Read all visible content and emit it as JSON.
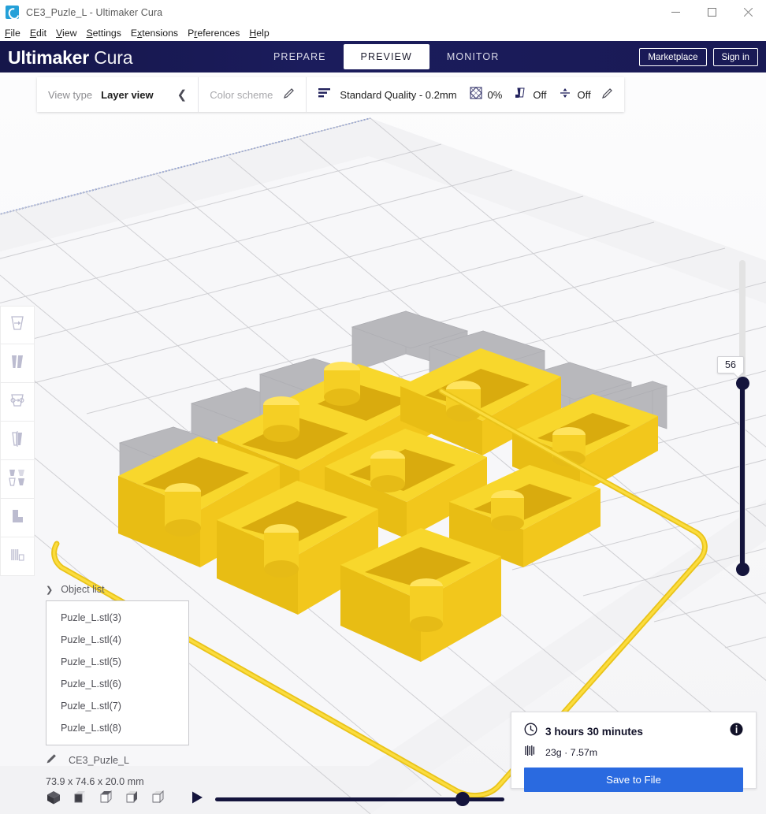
{
  "window": {
    "title": "CE3_Puzle_L - Ultimaker Cura",
    "app_icon": "cura-logo-icon",
    "controls": [
      {
        "name": "minimize-button",
        "glyph": "minimize-icon"
      },
      {
        "name": "maximize-button",
        "glyph": "maximize-icon"
      },
      {
        "name": "close-button",
        "glyph": "close-icon"
      }
    ]
  },
  "menubar": {
    "items": [
      {
        "label": "File",
        "mnemonic": "F"
      },
      {
        "label": "Edit",
        "mnemonic": "E"
      },
      {
        "label": "View",
        "mnemonic": "V"
      },
      {
        "label": "Settings",
        "mnemonic": "S"
      },
      {
        "label": "Extensions",
        "mnemonic": "x"
      },
      {
        "label": "Preferences",
        "mnemonic": "P"
      },
      {
        "label": "Help",
        "mnemonic": "H"
      }
    ]
  },
  "header": {
    "brand_bold": "Ultimaker",
    "brand_light": "Cura",
    "tabs": [
      {
        "label": "PREPARE",
        "active": false
      },
      {
        "label": "PREVIEW",
        "active": true
      },
      {
        "label": "MONITOR",
        "active": false
      }
    ],
    "marketplace_label": "Marketplace",
    "signin_label": "Sign in",
    "bg_color": "#1b1c5c"
  },
  "viewbar": {
    "view_type_label": "View type",
    "view_type_value": "Layer view",
    "collapse_icon": "chevron-left-icon",
    "color_scheme_label": "Color scheme",
    "color_scheme_edit_icon": "pencil-icon",
    "quality_icon": "layer-height-icon",
    "quality_value": "Standard Quality - 0.2mm",
    "infill_icon": "infill-icon",
    "infill_value": "0%",
    "support_icon": "support-icon",
    "support_value": "Off",
    "adhesion_icon": "adhesion-icon",
    "adhesion_value": "Off",
    "settings_edit_icon": "pencil-icon"
  },
  "tools": [
    {
      "name": "move-tool",
      "icon": "move-icon"
    },
    {
      "name": "scale-tool",
      "icon": "scale-icon"
    },
    {
      "name": "rotate-tool",
      "icon": "rotate-icon"
    },
    {
      "name": "mirror-tool",
      "icon": "mirror-icon"
    },
    {
      "name": "per-model-settings-tool",
      "icon": "per-model-settings-icon"
    },
    {
      "name": "support-blocker-tool",
      "icon": "support-blocker-icon"
    },
    {
      "name": "mesh-tool",
      "icon": "mesh-icon"
    }
  ],
  "layer_slider": {
    "value": "56",
    "top_handle_name": "layer-slider-upper-handle",
    "bottom_handle_name": "layer-slider-lower-handle"
  },
  "object_list": {
    "title": "Object list",
    "caret_icon": "chevron-down-icon",
    "items": [
      "Puzle_L.stl(3)",
      "Puzle_L.stl(4)",
      "Puzle_L.stl(5)",
      "Puzle_L.stl(6)",
      "Puzle_L.stl(7)",
      "Puzle_L.stl(8)"
    ],
    "model_edit_icon": "pencil-icon",
    "model_name": "CE3_Puzle_L",
    "model_dimensions": "73.9 x 74.6 x 20.0 mm"
  },
  "print_info": {
    "time_icon": "clock-icon",
    "time": "3 hours 30 minutes",
    "info_icon": "info-icon",
    "material_icon": "filament-icon",
    "material": "23g · 7.57m",
    "save_label": "Save to File",
    "save_color": "#2a6ae0"
  },
  "bottom_bar": {
    "view_cubes": [
      {
        "name": "view-cube-iso",
        "icon": "cube-iso-icon"
      },
      {
        "name": "view-cube-front",
        "icon": "cube-front-icon"
      },
      {
        "name": "view-cube-top",
        "icon": "cube-top-icon"
      },
      {
        "name": "view-cube-left",
        "icon": "cube-left-icon"
      },
      {
        "name": "view-cube-right",
        "icon": "cube-right-icon"
      }
    ],
    "play_icon": "play-icon",
    "simulation_position_pct": "83"
  },
  "scene": {
    "model_color": "#f5ce1e",
    "ghost_color": "#b4b4b8",
    "plate_color": "#f0f0f2",
    "grid_color": "#c9c9cd",
    "plate_edge_color": "#3b5ec8"
  }
}
